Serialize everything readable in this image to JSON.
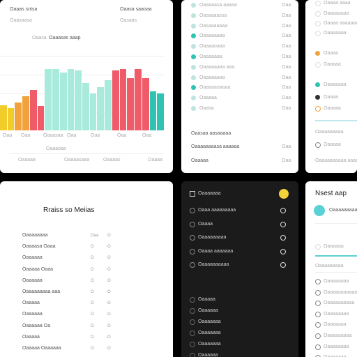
{
  "colors": {
    "yellow": "#f2cc2a",
    "orange": "#f2a23a",
    "red": "#ef5b68",
    "mint": "#a8eadc",
    "teal": "#2fc4b2",
    "panel_dark": "#1b1b1b",
    "badge_yellow": "#f5d23a",
    "accent_cyan": "#5bd0d6"
  },
  "chart_panel": {
    "header_left": "Oaaas sntsa",
    "header_right": "Oaasa saaoaa",
    "sub_left": "Oaasaasa",
    "sub_right": "Oasaas",
    "row2_left": "Oaasa",
    "row2_right": "Oaaasas aaap",
    "x_labels": [
      "Oaa",
      "Oaa",
      "Oaaasaa",
      "Oaa",
      "Oaa",
      "Oaa",
      "Oaa"
    ],
    "footer_mid": "Oaaaoaa",
    "footer_items": [
      "Oaaaaa",
      "Oaaaasaaa",
      "Oaaaas",
      "Oaaaa",
      "Oaa"
    ]
  },
  "chart_data": {
    "type": "bar",
    "categories": [],
    "values": [
      34,
      30,
      37,
      46,
      54,
      33,
      82,
      82,
      78,
      82,
      80,
      64,
      50,
      58,
      67,
      80,
      82,
      70,
      82,
      70,
      52,
      50
    ],
    "colors": [
      "#f2cc2a",
      "#f2cc2a",
      "#f2a23a",
      "#f2a23a",
      "#ef5b68",
      "#ef5b68",
      "#a8eadc",
      "#a8eadc",
      "#a8eadc",
      "#a8eadc",
      "#a8eadc",
      "#a8eadc",
      "#a8eadc",
      "#a8eadc",
      "#a8eadc",
      "#ef5b68",
      "#ef5b68",
      "#ef5b68",
      "#ef5b68",
      "#ef5b68",
      "#2fc4b2",
      "#2fc4b2"
    ],
    "ylim": [
      0,
      100
    ],
    "grid": true
  },
  "list_panel": {
    "items": [
      {
        "label": "Oaaaaasa aaaaa",
        "meta": "Oaa",
        "dot": "#bfe4e0"
      },
      {
        "label": "Oasaaaassa",
        "meta": "Oaa",
        "dot": "#bfe4e0"
      },
      {
        "label": "Oasaaaaaaa",
        "meta": "Oaa",
        "dot": "#bfe4e0"
      },
      {
        "label": "Oaaaaaaaa",
        "meta": "Oaa",
        "dot": "#2fc4b2"
      },
      {
        "label": "Oaaaaoaaa",
        "meta": "Oaa",
        "dot": "#bfe4e0"
      },
      {
        "label": "Oaaaaaaa",
        "meta": "Oaa",
        "dot": "#2fc4b2"
      },
      {
        "label": "Oaaaaaaaa aaa",
        "meta": "Oaa",
        "dot": "#bfe4e0"
      },
      {
        "label": "Oaaaaaaaa",
        "meta": "Oaa",
        "dot": "#bfe4e0"
      },
      {
        "label": "Oaaaaaoaaaa",
        "meta": "Oaa",
        "dot": "#2fc4b2"
      },
      {
        "label": "Oaaaaa",
        "meta": "Oaa",
        "dot": "#bfe4e0"
      },
      {
        "label": "Oaasa",
        "meta": "Oaa",
        "dot": "#bfe4e0"
      }
    ],
    "footer_a": "Oaasaa aasaaaaa",
    "footer_b": "Oaaaaaaaasa aaaaaa",
    "footer_b_meta": "Oaa",
    "footer_c": "Oaaaaa",
    "footer_c_meta": "Oaa"
  },
  "right_top_panel": {
    "items": [
      {
        "label": "Oaaaa aaaa",
        "icon": "ring"
      },
      {
        "label": "Oaaaaaaaa",
        "icon": "ring"
      },
      {
        "label": "Oaaaa aaaaaaaa",
        "icon": "ring"
      },
      {
        "label": "Oaaaaaaa",
        "icon": "ring"
      },
      {
        "label": "Oaaaa",
        "icon": "orange"
      },
      {
        "label": "Oaaaaa",
        "icon": "ring"
      },
      {
        "label": "Oaaaaaaa",
        "icon": "teal"
      },
      {
        "label": "Oaaaa",
        "icon": "dark"
      },
      {
        "label": "Oaaaaa",
        "icon": "ring-orange"
      }
    ],
    "bottom_a": "Oaaaaaaaaa",
    "bottom_b": "Oaaaaa",
    "bottom_c": "Oaaaaaaaaaa aaaaa"
  },
  "table_panel": {
    "title": "Rraiss so Meiias",
    "rows": [
      {
        "label": "Oaaaaaaaa",
        "c1": "Oaa",
        "c2": "O"
      },
      {
        "label": "Oaaaasa Oaaa",
        "c1": "O",
        "c2": "O"
      },
      {
        "label": "Oaaaaaa",
        "c1": "O",
        "c2": "O"
      },
      {
        "label": "Oaaaaa Oaaa",
        "c1": "O",
        "c2": "O"
      },
      {
        "label": "Oaaaaaa",
        "c1": "O",
        "c2": "O"
      },
      {
        "label": "Oaaaaaaaaa aaa",
        "c1": "O",
        "c2": "O"
      },
      {
        "label": "Oaaaaa",
        "c1": "O",
        "c2": "O"
      },
      {
        "label": "Oaaaaaa",
        "c1": "O",
        "c2": "O"
      },
      {
        "label": "Oaaaaaa Oa",
        "c1": "O",
        "c2": "O"
      },
      {
        "label": "Oaaaaa",
        "c1": "O",
        "c2": "O"
      },
      {
        "label": "Oaaaaa Oaaaaaa",
        "c1": "O",
        "c2": "O"
      }
    ]
  },
  "dark_panel": {
    "header": "Oaaaaaaa",
    "items": [
      "Oaaa aaaaaaaaa",
      "Oaaaa",
      "Oaaaaaaaaa",
      "Oaaaa aaaaaaa",
      "Oaaaaaaaaaa"
    ],
    "items_bottom": [
      "Oaaaaa",
      "Oaaaaaa",
      "Oaaaaaaa",
      "Oaaaaaaa",
      "Oaaaaaaa",
      "Oaaaaaa"
    ]
  },
  "right_bottom_panel": {
    "title": "Nsest aap",
    "user": "Oaaaaaaaaaaa",
    "sub": "Oaaaaaa",
    "slider_label": "Oaaaaaaaaa",
    "items": [
      "Oaaaaaaaa",
      "Oaaaaaaaaaaa",
      "Oaaaaaaaaaa",
      "Oaaaaaaaa",
      "Oaaaaaaa",
      "Oaaaaaaaaa",
      "Oaaaaaaaa",
      "Oaaaaaaa"
    ]
  }
}
